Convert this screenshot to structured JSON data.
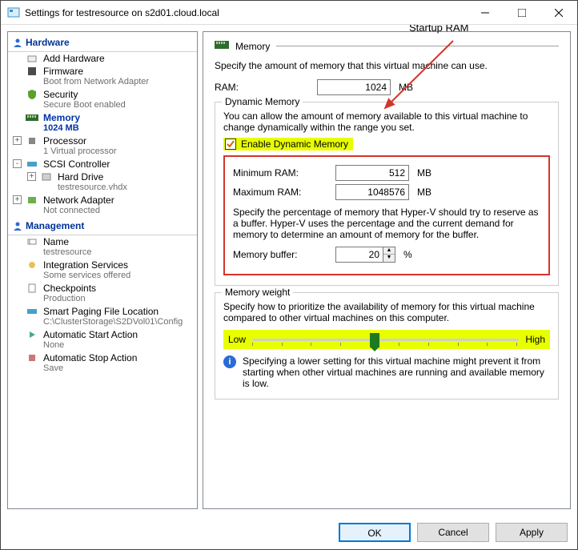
{
  "window": {
    "title": "Settings for testresource on s2d01.cloud.local"
  },
  "callout": "Startup RAM",
  "sidebar": {
    "hardware_label": "Hardware",
    "management_label": "Management",
    "items": [
      {
        "label": "Add Hardware"
      },
      {
        "label": "Firmware",
        "sub": "Boot from Network Adapter"
      },
      {
        "label": "Security",
        "sub": "Secure Boot enabled"
      },
      {
        "label": "Memory",
        "sub": "1024 MB",
        "selected": true
      },
      {
        "label": "Processor",
        "sub": "1 Virtual processor",
        "exp": "+"
      },
      {
        "label": "SCSI Controller",
        "exp": "-"
      },
      {
        "label": "Hard Drive",
        "sub": "testresource.vhdx",
        "child": true,
        "exp": "+"
      },
      {
        "label": "Network Adapter",
        "sub": "Not connected",
        "exp": "+"
      }
    ],
    "mgmt": [
      {
        "label": "Name",
        "sub": "testresource"
      },
      {
        "label": "Integration Services",
        "sub": "Some services offered"
      },
      {
        "label": "Checkpoints",
        "sub": "Production"
      },
      {
        "label": "Smart Paging File Location",
        "sub": "C:\\ClusterStorage\\S2DVol01\\Config"
      },
      {
        "label": "Automatic Start Action",
        "sub": "None"
      },
      {
        "label": "Automatic Stop Action",
        "sub": "Save"
      }
    ]
  },
  "pane": {
    "header": "Memory",
    "desc": "Specify the amount of memory that this virtual machine can use.",
    "ram_label": "RAM:",
    "ram_value": "1024",
    "unit": "MB",
    "dyn": {
      "title": "Dynamic Memory",
      "desc": "You can allow the amount of memory available to this virtual machine to change dynamically within the range you set.",
      "enable_label": "Enable Dynamic Memory",
      "min_label": "Minimum RAM:",
      "min_value": "512",
      "max_label": "Maximum RAM:",
      "max_value": "1048576",
      "buffer_desc": "Specify the percentage of memory that Hyper-V should try to reserve as a buffer. Hyper-V uses the percentage and the current demand for memory to determine an amount of memory for the buffer.",
      "buffer_label": "Memory buffer:",
      "buffer_value": "20",
      "pct": "%"
    },
    "weight": {
      "title": "Memory weight",
      "desc": "Specify how to prioritize the availability of memory for this virtual machine compared to other virtual machines on this computer.",
      "low": "Low",
      "high": "High",
      "info": "Specifying a lower setting for this virtual machine might prevent it from starting when other virtual machines are running and available memory is low."
    }
  },
  "buttons": {
    "ok": "OK",
    "cancel": "Cancel",
    "apply": "Apply"
  }
}
